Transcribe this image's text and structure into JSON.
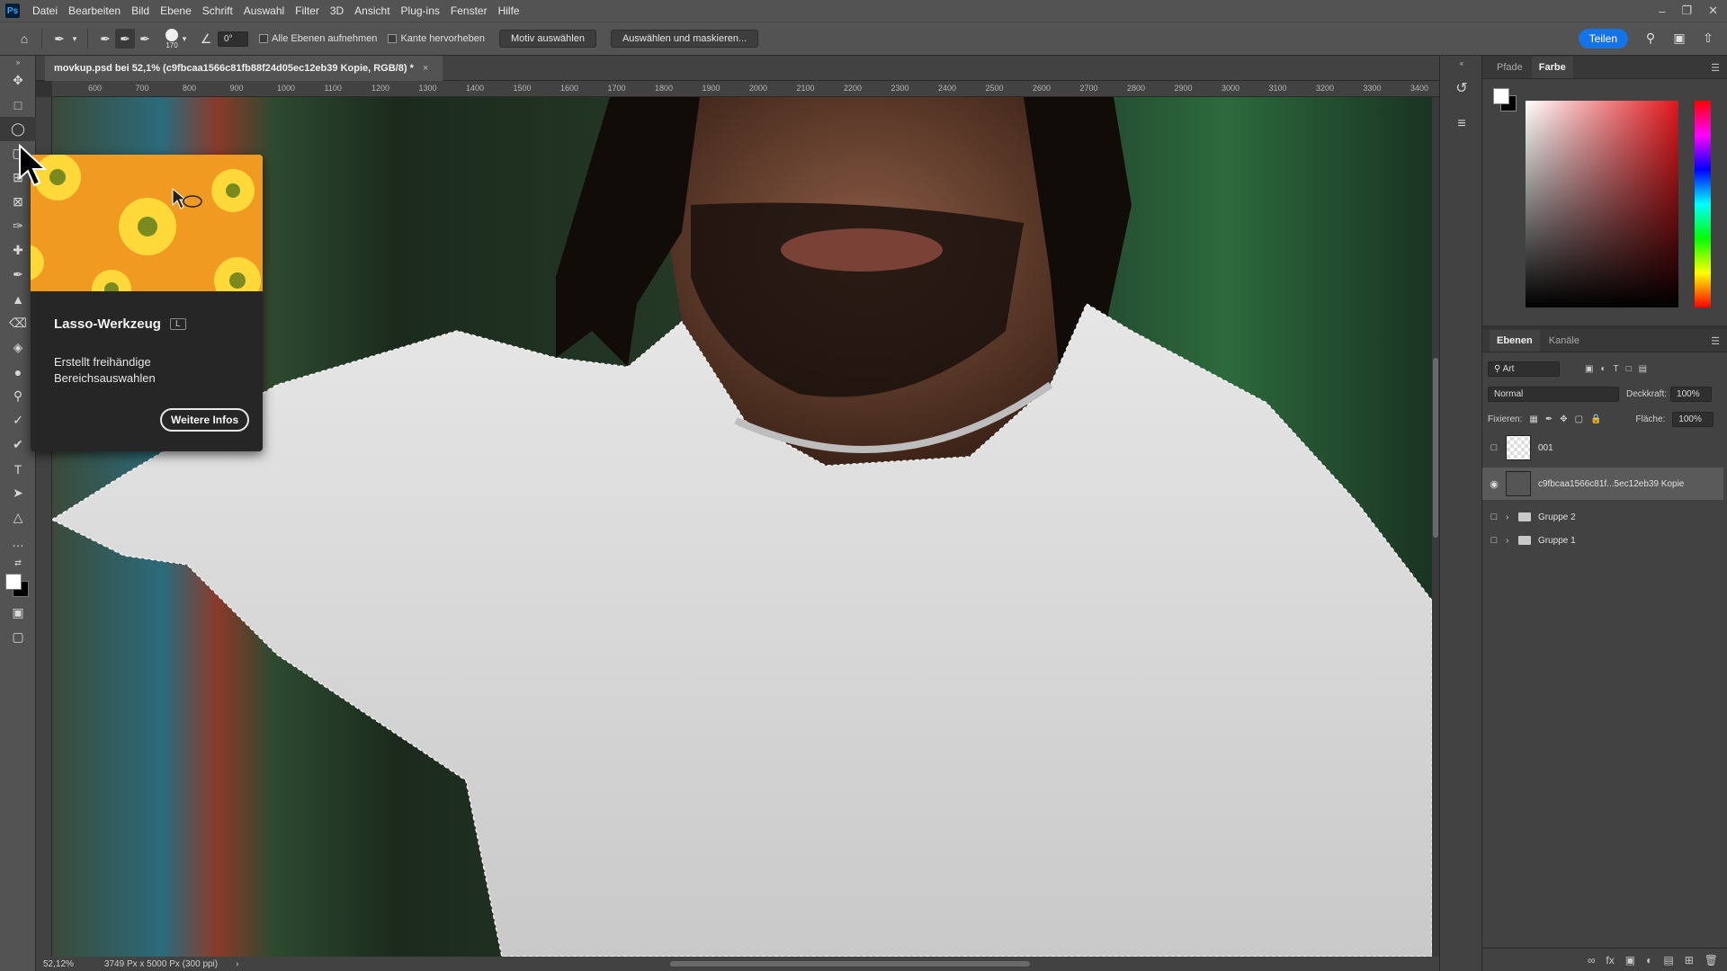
{
  "app": {
    "logo": "Ps"
  },
  "menu": [
    "Datei",
    "Bearbeiten",
    "Bild",
    "Ebene",
    "Schrift",
    "Auswahl",
    "Filter",
    "3D",
    "Ansicht",
    "Plug-ins",
    "Fenster",
    "Hilfe"
  ],
  "options": {
    "brush_size": "170",
    "angle": "0°",
    "sample_all_layers": "Alle Ebenen aufnehmen",
    "enhance_edge": "Kante hervorheben",
    "select_subject": "Motiv auswählen",
    "select_and_mask": "Auswählen und maskieren...",
    "share": "Teilen"
  },
  "document": {
    "tab_title": "movkup.psd bei 52,1% (c9fbcaa1566c81fb88f24d05ec12eb39 Kopie, RGB/8) *",
    "zoom": "52,12%",
    "info": "3749 Px x 5000 Px (300 ppi)"
  },
  "ruler_ticks": [
    "600",
    "700",
    "800",
    "900",
    "1000",
    "1100",
    "1200",
    "1300",
    "1400",
    "1500",
    "1600",
    "1700",
    "1800",
    "1900",
    "2000",
    "2100",
    "2200",
    "2300",
    "2400",
    "2500",
    "2600",
    "2700",
    "2800",
    "2900",
    "3000",
    "3100",
    "3200",
    "3300",
    "3400"
  ],
  "tooltip": {
    "title": "Lasso-Werkzeug",
    "shortcut": "L",
    "description": "Erstellt freihändige Bereichsauswahlen",
    "button": "Weitere Infos"
  },
  "color_panel": {
    "tabs": [
      "Pfade",
      "Farbe"
    ],
    "active_tab": "Farbe",
    "foreground": "#ffffff",
    "background": "#000000"
  },
  "layers_panel": {
    "tabs": [
      "Ebenen",
      "Kanäle"
    ],
    "active_tab": "Ebenen",
    "filter": "Art",
    "blend_mode": "Normal",
    "opacity_label": "Deckkraft:",
    "opacity": "100%",
    "lock_label": "Fixieren:",
    "fill_label": "Fläche:",
    "fill": "100%",
    "layers": [
      {
        "name": "001",
        "visible": false,
        "type": "layer"
      },
      {
        "name": "c9fbcaa1566c81f...5ec12eb39 Kopie",
        "visible": true,
        "type": "layer",
        "selected": true
      },
      {
        "name": "Gruppe 2",
        "visible": false,
        "type": "group"
      },
      {
        "name": "Gruppe 1",
        "visible": false,
        "type": "group"
      }
    ]
  },
  "colors": {
    "accent": "#1473e6",
    "ui_bg": "#535353",
    "panel_bg": "#424242"
  }
}
